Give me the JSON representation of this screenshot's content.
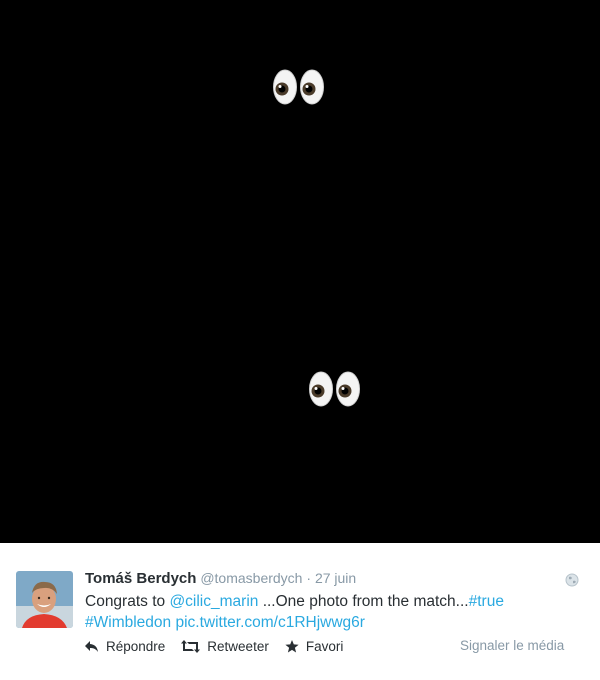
{
  "media": {
    "background": "#000000",
    "content": "eyes-emoji-pairs",
    "emoji": [
      "👀",
      "👀"
    ]
  },
  "tweet": {
    "author_name": "Tomáš Berdych",
    "author_handle": "@tomasberdych",
    "separator": "·",
    "date": "27 juin",
    "text_prefix": "Congrats to ",
    "mention": "@cilic_marin",
    "text_middle": " ...One photo from the match...",
    "hashtag_true": "#true",
    "hashtag_wimbledon": "#Wimbledon",
    "pic_link": "pic.twitter.com/c1RHjwwg6r",
    "link_color": "#2aa9e0"
  },
  "actions": {
    "reply_label": "Répondre",
    "retweet_label": "Retweeter",
    "favorite_label": "Favori",
    "report_label": "Signaler le média"
  }
}
